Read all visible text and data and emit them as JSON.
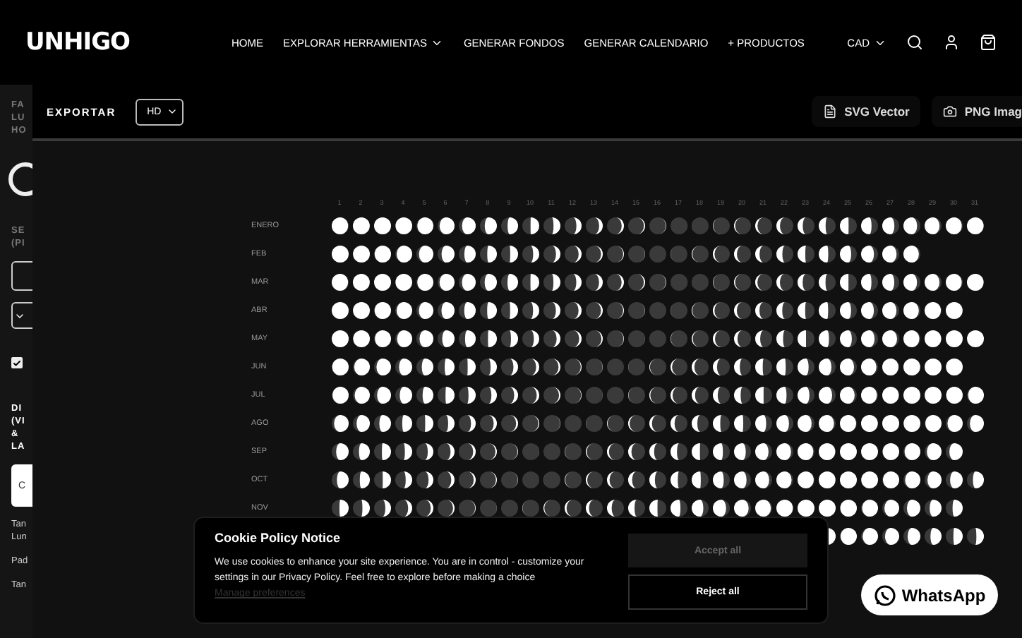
{
  "header": {
    "logo": "UNHIGO",
    "nav": [
      {
        "label": "HOME",
        "dropdown": false
      },
      {
        "label": "EXPLORAR HERRAMIENTAS",
        "dropdown": true
      },
      {
        "label": "GENERAR FONDOS",
        "dropdown": false
      },
      {
        "label": "GENERAR CALENDARIO",
        "dropdown": false
      },
      {
        "label": "+ PRODUCTOS",
        "dropdown": false
      }
    ],
    "currency": "CAD"
  },
  "sidebar": {
    "heading": "FA\nLU\nHO",
    "section": "SE\n(PI",
    "checked": true,
    "section_2": "DI\n(VI\n&\nLA",
    "button": "C",
    "notes": [
      "Tan\nLun",
      "Pad",
      "Tan"
    ]
  },
  "toolbar": {
    "label": "EXPORTAR",
    "quality": "HD",
    "buttons": [
      {
        "label": "SVG Vector",
        "kind": "file"
      },
      {
        "label": "PNG Imag",
        "kind": "camera"
      }
    ]
  },
  "calendar": {
    "days": [
      "1",
      "2",
      "3",
      "4",
      "5",
      "6",
      "7",
      "8",
      "9",
      "10",
      "11",
      "12",
      "13",
      "14",
      "15",
      "16",
      "17",
      "18",
      "19",
      "20",
      "21",
      "22",
      "23",
      "24",
      "25",
      "26",
      "27",
      "28",
      "29",
      "30",
      "31"
    ],
    "months": [
      "ENERO",
      "FEB",
      "MAR",
      "ABR",
      "MAY",
      "JUN",
      "JUL",
      "AGO",
      "SEP",
      "OCT",
      "NOV"
    ]
  },
  "cookie": {
    "title": "Cookie Policy Notice",
    "text": "We use cookies to enhance your site experience. You are in control - customize your settings in our Privacy Policy. Feel free to explore before making a choice",
    "link": "Manage preferences",
    "accept": "Accept all",
    "reject": "Reject all"
  },
  "whatsapp": "WhatsApp"
}
